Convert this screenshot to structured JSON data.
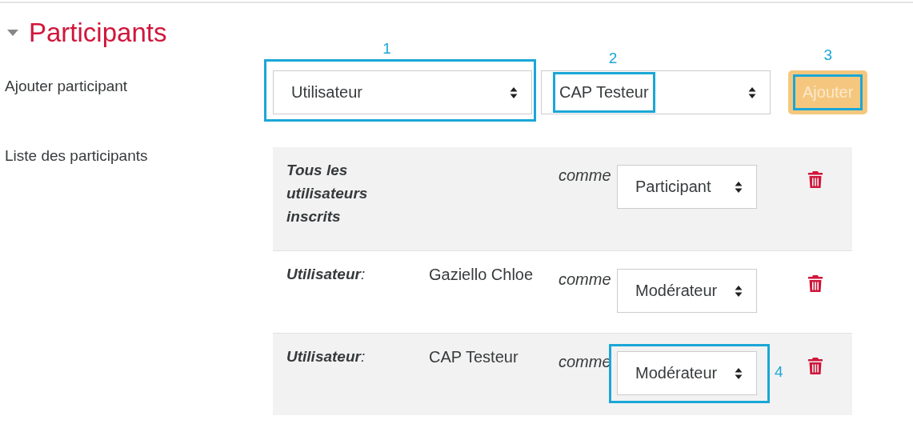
{
  "section": {
    "title": "Participants",
    "expanded": true
  },
  "add": {
    "label": "Ajouter participant",
    "type_select": {
      "value": "Utilisateur",
      "callout": "1"
    },
    "user_select": {
      "value": "CAP Testeur",
      "callout": "2"
    },
    "button": {
      "label": "Ajouter",
      "disabled": true,
      "callout": "3"
    }
  },
  "list": {
    "label": "Liste des participants",
    "rows": [
      {
        "kind": "all",
        "label": "Tous les utilisateurs inscrits",
        "connector": "comme",
        "role": "Participant"
      },
      {
        "kind": "user",
        "label": "**Utilisateur**:",
        "name": "Gaziello Chloe",
        "connector": "comme",
        "role": "Modérateur"
      },
      {
        "kind": "user",
        "label": "**Utilisateur**:",
        "name": "CAP Testeur",
        "connector": "comme",
        "role": "Modérateur",
        "callout": "4"
      }
    ]
  }
}
